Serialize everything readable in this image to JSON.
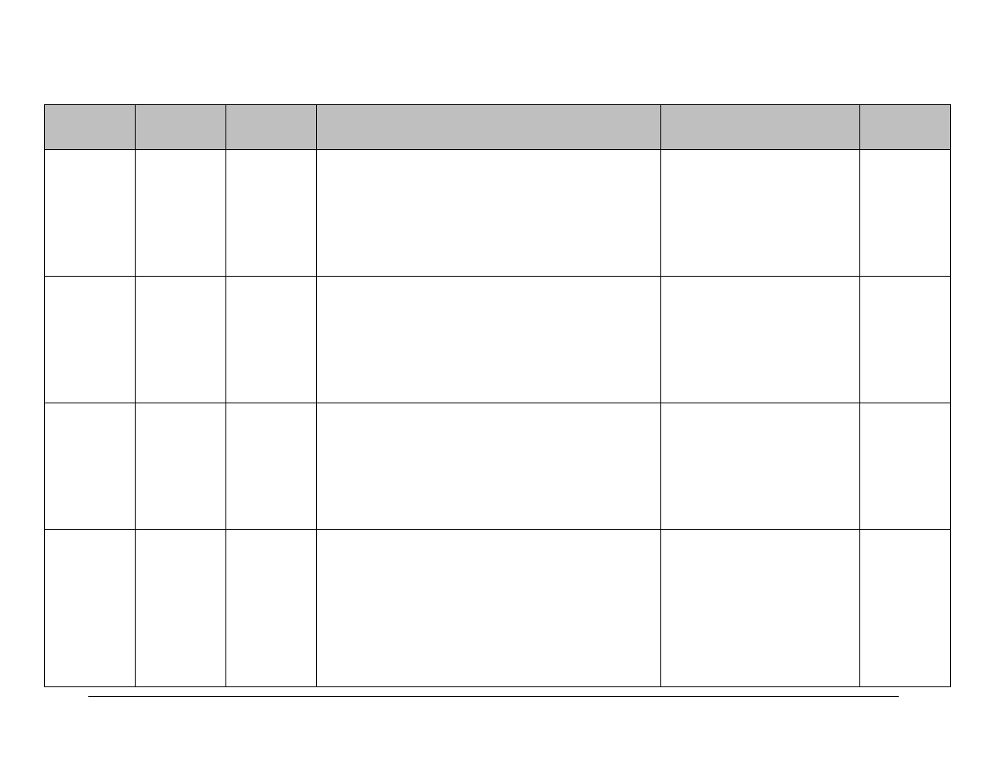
{
  "table": {
    "headers": [
      "",
      "",
      "",
      "",
      "",
      ""
    ],
    "rows": [
      [
        "",
        "",
        "",
        "",
        "",
        ""
      ],
      [
        "",
        "",
        "",
        "",
        "",
        ""
      ],
      [
        "",
        "",
        "",
        "",
        "",
        ""
      ],
      [
        "",
        "",
        "",
        "",
        "",
        ""
      ]
    ]
  }
}
